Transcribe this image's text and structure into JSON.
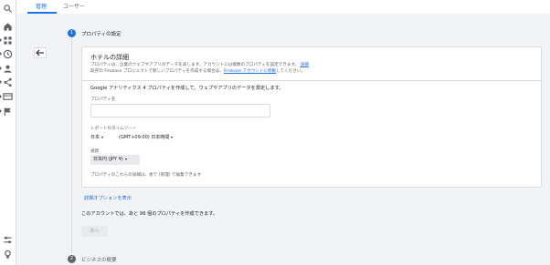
{
  "tabs": [
    {
      "label": "管理"
    },
    {
      "label": "ユーザー"
    }
  ],
  "steps": [
    {
      "number": "1",
      "title": "プロパティの設定",
      "active": true
    },
    {
      "number": "2",
      "title": "ビジネスの概要",
      "active": false
    }
  ],
  "card": {
    "title": "ホテルの詳細",
    "desc1": "プロパティは、企業のウェブやアプリのデータを表します。アカウントには複数のプロパティを設定できます。",
    "desc1_link": "詳細",
    "desc2": "既存の Firebase プロジェクトで新しいプロパティを作成する場合は、",
    "desc2_link": "Firebase アカウントに移動",
    "desc2_end": "してください。",
    "lead": "Google アナリティクス 4 プロパティを作成して、ウェブやアプリのデータを測定します。",
    "property_name_label": "プロパティ名",
    "property_name_value": "",
    "timezone_label": "レポートのタイムゾーン",
    "country_value": "日本",
    "timezone_value": "(GMT+09:00) 日本時間",
    "currency_label": "通貨",
    "currency_value": "日本円 (JPY ¥)",
    "note": "プロパティのこれらの詳細は、後で [管理] で編集できます"
  },
  "advanced_link": "詳細オプションを表示",
  "remaining_text": "このアカウントでは、あと 96 個のプロパティを作成できます。",
  "next_label": "次へ",
  "colors": {
    "accent": "#1a73e8",
    "background": "#f1f3f4",
    "step_inactive": "#5f6368"
  },
  "sidebar_icons": [
    "search-icon",
    "home-icon",
    "reports-icon",
    "clock-icon",
    "person-icon",
    "share-icon",
    "monitor-icon",
    "flag-icon",
    "settings-tune-icon",
    "lightbulb-icon"
  ]
}
